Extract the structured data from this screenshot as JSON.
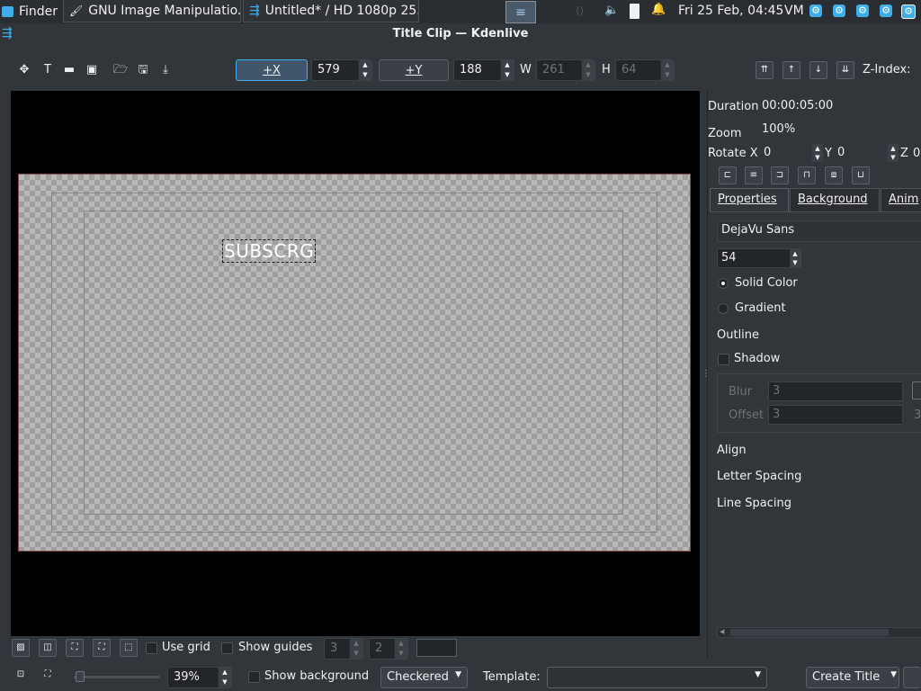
{
  "taskbar": {
    "finder_label": "Finder",
    "tasks": [
      "GNU Image Manipulatio...",
      "Untitled* / HD 1080p 25..."
    ],
    "clock": "Fri 25 Feb, 04:45",
    "vm_label": "VM"
  },
  "window": {
    "title": "Title Clip — Kdenlive"
  },
  "toolbar": {
    "x_button": "+X",
    "x_value": "579",
    "y_button": "+Y",
    "y_value": "188",
    "w_label": "W",
    "w_value": "261",
    "h_label": "H",
    "h_value": "64",
    "zindex_label": "Z-Index:"
  },
  "canvas": {
    "title_text": "SUBSCRG"
  },
  "panel": {
    "duration_label": "Duration",
    "duration_value": "00:00:05:00",
    "zoom_label": "Zoom",
    "zoom_value": "100%",
    "rotate_x_label": "Rotate X",
    "rotate_x_value": "0",
    "rotate_y_label": "Y",
    "rotate_y_value": "0",
    "rotate_z_label": "Z",
    "rotate_z_value": "0",
    "tabs": [
      "Properties",
      "Background",
      "Anim"
    ],
    "font_family": "DejaVu Sans",
    "font_size": "54",
    "solid_color": "Solid Color",
    "gradient": "Gradient",
    "outline": "Outline",
    "shadow": "Shadow",
    "blur_label": "Blur",
    "blur_value": "3",
    "offset_label": "Offset",
    "offset_value": "3",
    "offset_value2": "3",
    "align": "Align",
    "letter_spacing": "Letter Spacing",
    "line_spacing": "Line Spacing"
  },
  "bottom1": {
    "use_grid": "Use grid",
    "show_guides": "Show guides",
    "guides_h": "3",
    "guides_v": "2"
  },
  "bottom2": {
    "zoom_value": "39%",
    "show_background": "Show background",
    "background_mode": "Checkered",
    "template_label": "Template:",
    "template_value": "",
    "create_title": "Create Title"
  },
  "colors": {
    "accent": "#3daee9",
    "window_bg": "#31363b",
    "canvas_border": "#8a4b4b"
  }
}
